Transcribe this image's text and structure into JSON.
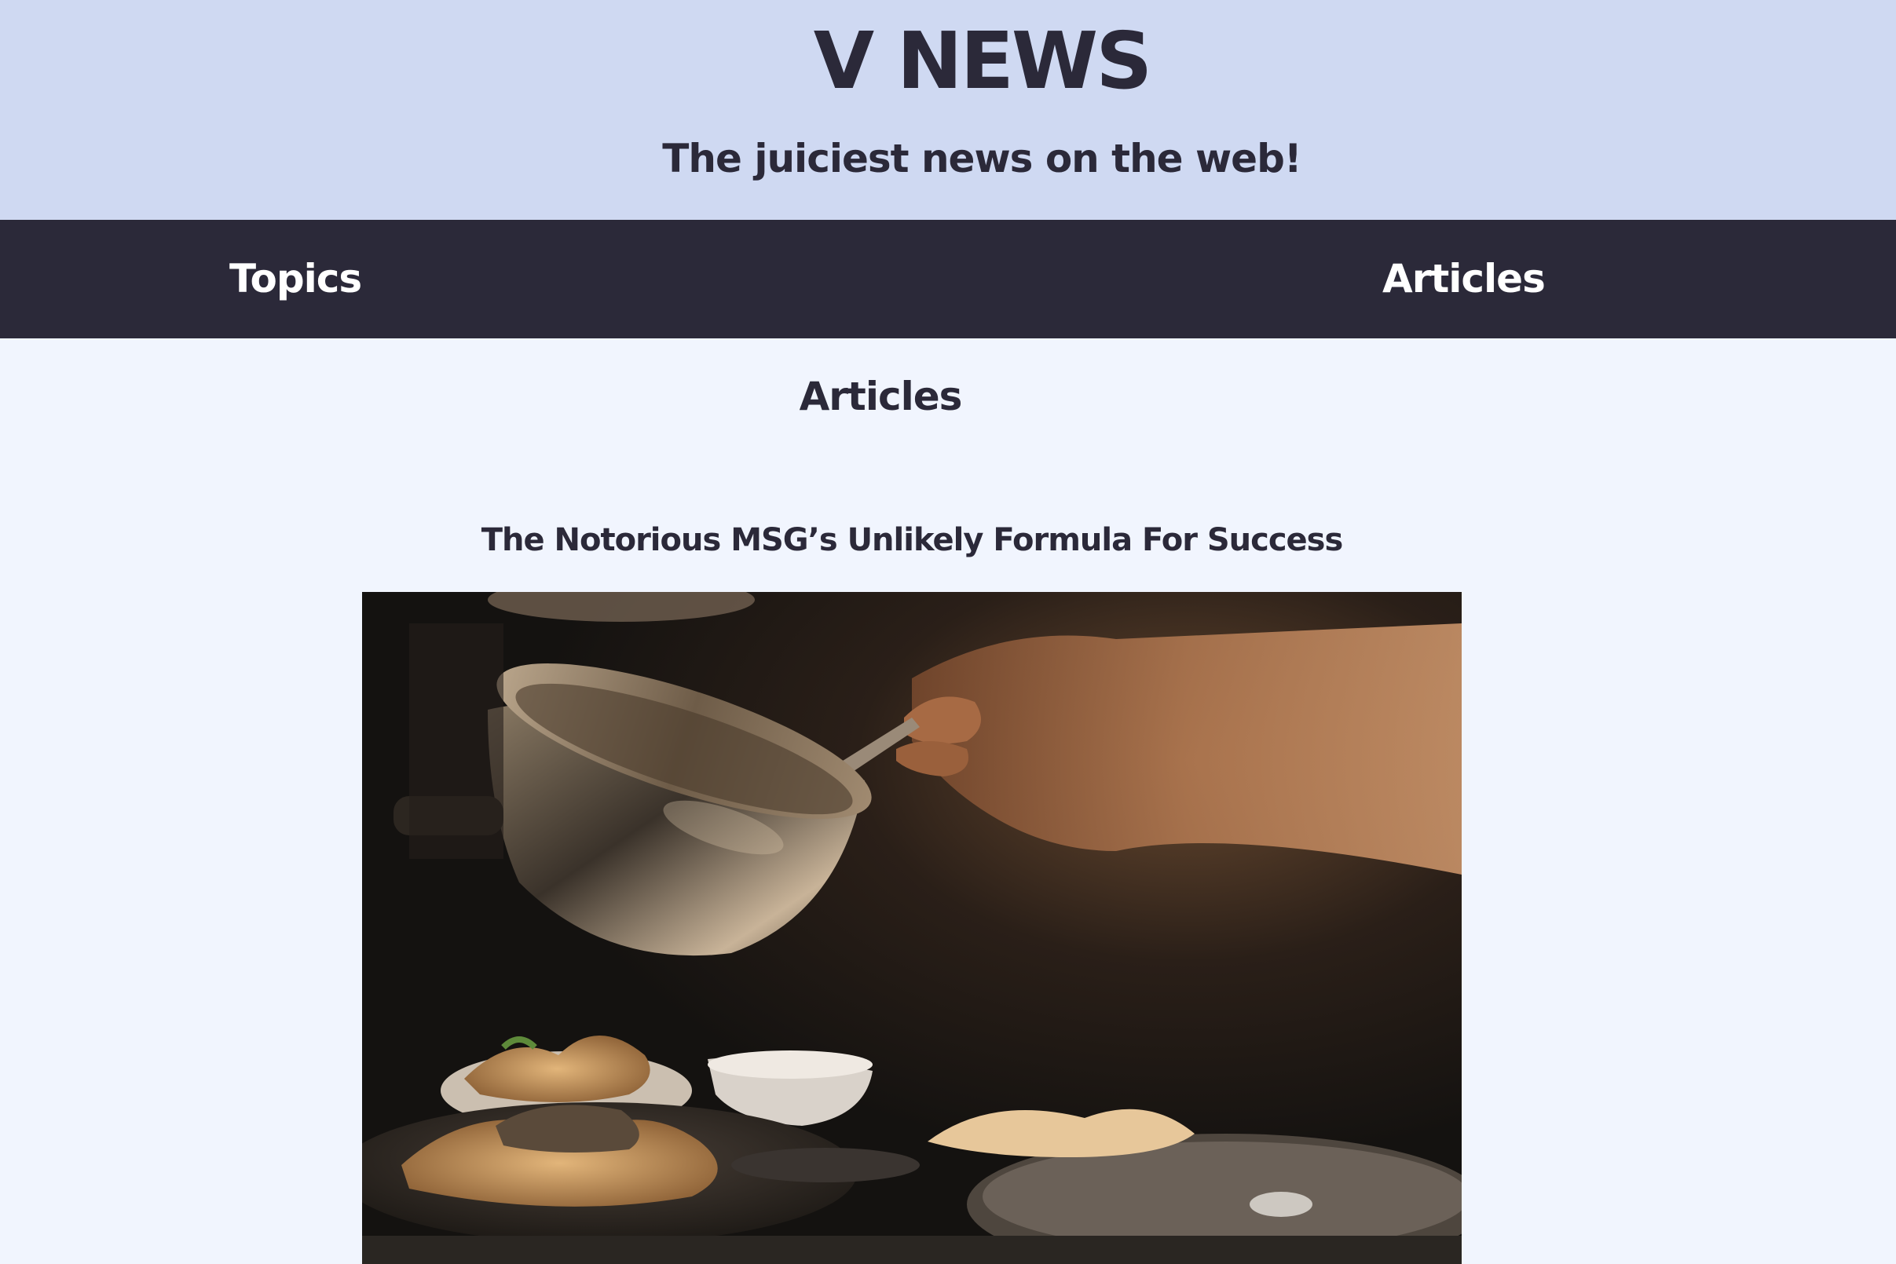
{
  "header": {
    "site_title": "V NEWS",
    "tagline": "The juiciest news on the web!"
  },
  "nav": {
    "items": [
      {
        "label": "Topics"
      },
      {
        "label": "Articles"
      }
    ]
  },
  "main": {
    "section_heading": "Articles",
    "articles": [
      {
        "title": "The Notorious MSG’s Unlikely Formula For Success",
        "image": "chef-pouring-sauce-photo"
      }
    ]
  },
  "colors": {
    "header_bg": "#cfd9f2",
    "nav_bg": "#2b2939",
    "page_bg": "#f1f5fe",
    "text": "#2b2939",
    "nav_text": "#ffffff"
  }
}
